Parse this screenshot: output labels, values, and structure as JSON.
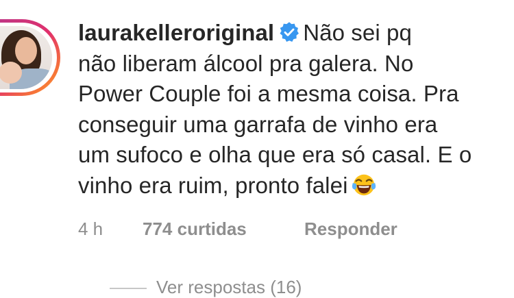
{
  "comment": {
    "username": "laurakelleroriginal",
    "verified_icon": "verified-badge-icon",
    "lines": [
      "Não sei pq",
      "não liberam álcool pra galera. No",
      "Power Couple foi a mesma coisa. Pra",
      "conseguir uma garrafa de vinho era",
      "um sufoco e olha que era só casal. E o",
      "vinho era ruim, pronto falei"
    ],
    "emoji": "face-with-tears-of-joy-icon"
  },
  "meta": {
    "time": "4 h",
    "likes": "774 curtidas",
    "reply": "Responder"
  },
  "view_replies": {
    "label": "Ver respostas (16)"
  },
  "colors": {
    "text": "#262626",
    "meta": "#8e8e8e",
    "verified": "#3897f0",
    "ring_start": "#c13584",
    "ring_end": "#fcaf45"
  }
}
